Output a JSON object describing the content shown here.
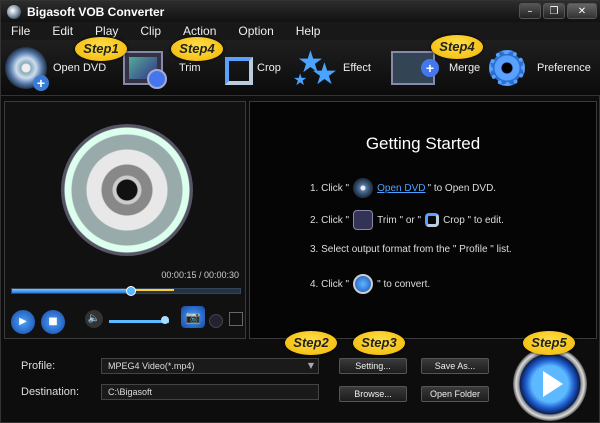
{
  "window": {
    "title": "Bigasoft VOB Converter"
  },
  "menu": [
    "File",
    "Edit",
    "Play",
    "Clip",
    "Action",
    "Option",
    "Help"
  ],
  "toolbar": {
    "open_dvd": "Open DVD",
    "trim": "Trim",
    "crop": "Crop",
    "effect": "Effect",
    "merge": "Merge",
    "preference": "Preference"
  },
  "steps": {
    "step1": "Step1",
    "step4a": "Step4",
    "step4b": "Step4",
    "step2": "Step2",
    "step3": "Step3",
    "step5": "Step5"
  },
  "player": {
    "time": "00:00:15 / 00:00:30",
    "progress": 0.52
  },
  "guide": {
    "title": "Getting Started",
    "l1_a": "1. Click \"",
    "l1_link": "Open DVD",
    "l1_b": "\" to Open DVD.",
    "l2_a": "2. Click \"",
    "l2_b": "Trim \" or \"",
    "l2_c": "Crop \" to edit.",
    "l3": "3. Select output  format from the \" Profile \" list.",
    "l4_a": "4. Click \"",
    "l4_b": "\" to convert."
  },
  "bottom": {
    "profile_label": "Profile:",
    "profile_value": "MPEG4 Video(*.mp4)",
    "destination_label": "Destination:",
    "destination_value": "C:\\Bigasoft",
    "setting_btn": "Setting...",
    "saveas_btn": "Save As...",
    "browse_btn": "Browse...",
    "openfolder_btn": "Open Folder"
  }
}
